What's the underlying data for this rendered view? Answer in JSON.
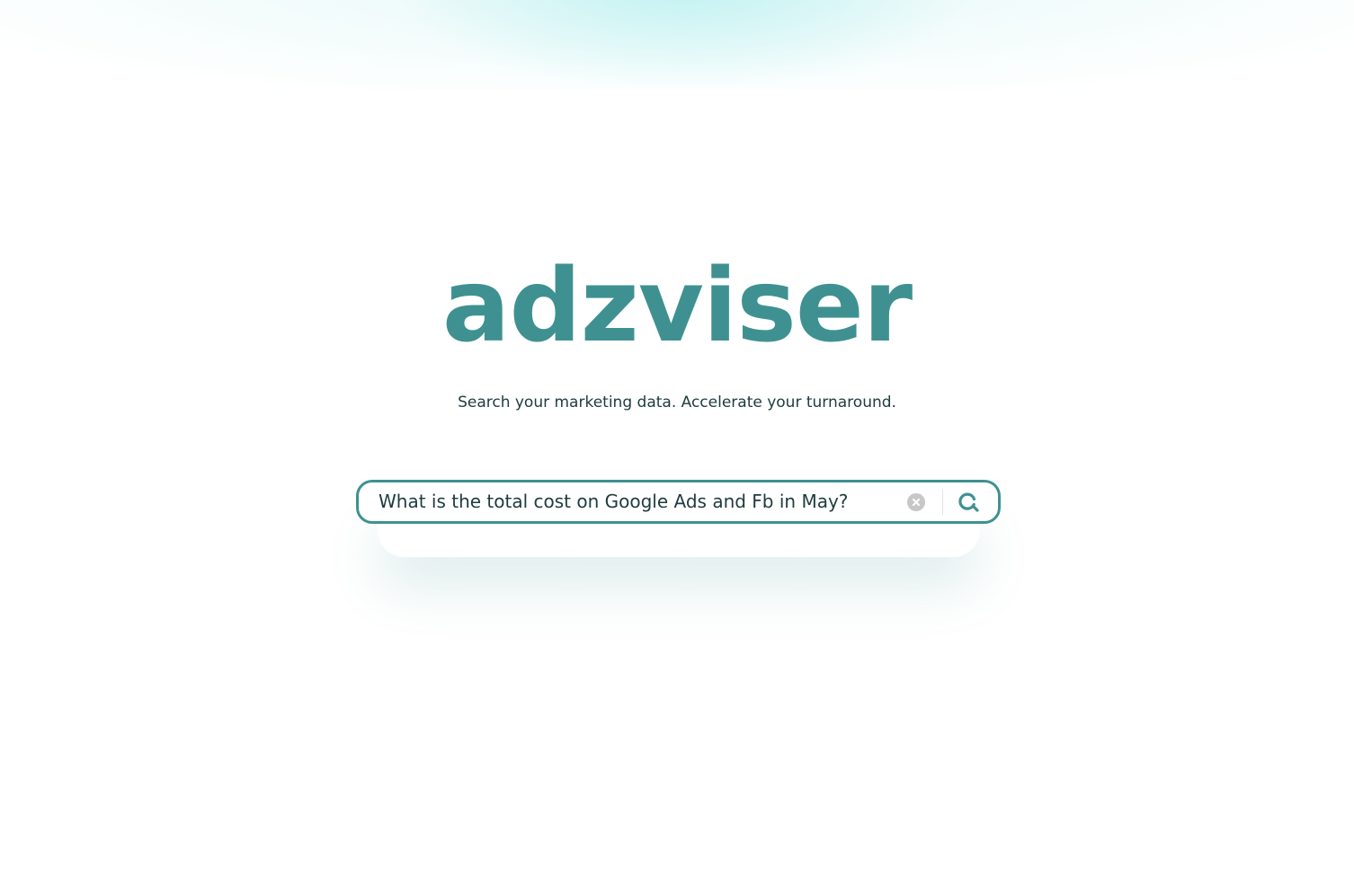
{
  "brand": {
    "logo_text": "adzviser",
    "tagline": "Search your marketing data. Accelerate your turnaround.",
    "accent_color": "#3f9191",
    "text_color": "#1e3b3d"
  },
  "search": {
    "value": "What is the total cost on Google Ads and Fb in May?",
    "clear_icon": "clear-circle-x-icon",
    "submit_icon": "search-icon"
  }
}
